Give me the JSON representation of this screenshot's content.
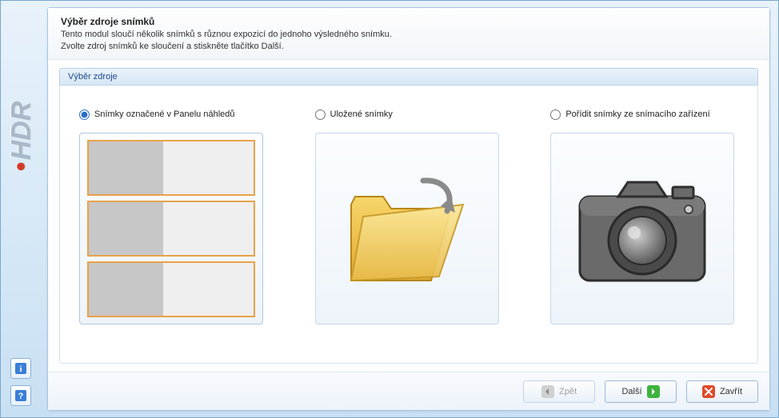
{
  "sidebar": {
    "logo": "HDR"
  },
  "header": {
    "title": "Výběr zdroje snímků",
    "line1": "Tento modul sloučí několik snímků s různou expozicí do jednoho výsledného snímku.",
    "line2": "Zvolte zdroj snímků ke sloučení a stiskněte tlačítko Další."
  },
  "group": {
    "title": "Výběr zdroje"
  },
  "options": {
    "panel": {
      "label": "Snímky označené v Panelu náhledů",
      "selected": true
    },
    "saved": {
      "label": "Uložené snímky",
      "selected": false
    },
    "capture": {
      "label": "Pořídit snímky ze snímacího zařízení",
      "selected": false
    }
  },
  "buttons": {
    "back": "Zpět",
    "next": "Další",
    "close": "Zavřít"
  }
}
